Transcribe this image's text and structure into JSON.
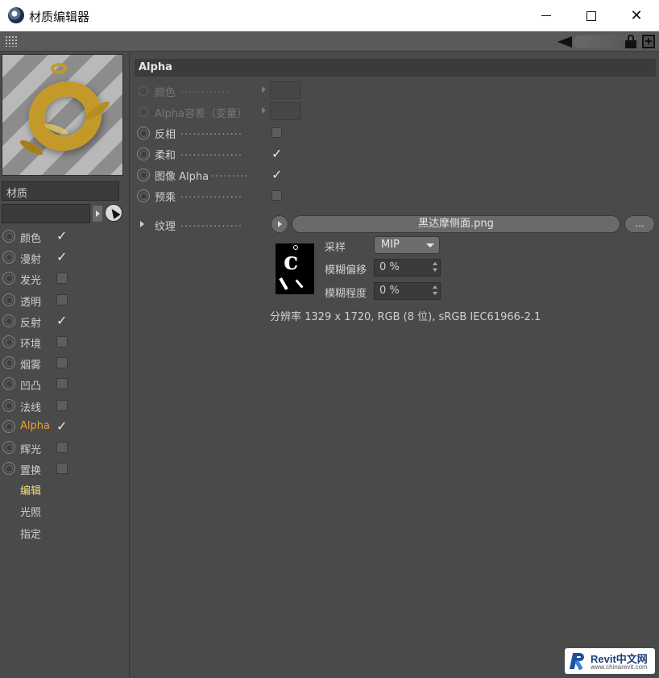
{
  "window": {
    "title": "材质编辑器",
    "minimize_icon": "minimize-icon",
    "maximize_icon": "maximize-icon",
    "close_glyph": "✕"
  },
  "material": {
    "name": "材质"
  },
  "channels": [
    {
      "label": "颜色",
      "checked": true,
      "active": false
    },
    {
      "label": "漫射",
      "checked": true,
      "active": false
    },
    {
      "label": "发光",
      "checked": false,
      "active": false
    },
    {
      "label": "透明",
      "checked": false,
      "active": false
    },
    {
      "label": "反射",
      "checked": true,
      "active": false
    },
    {
      "label": "环境",
      "checked": false,
      "active": false
    },
    {
      "label": "烟雾",
      "checked": false,
      "active": false
    },
    {
      "label": "凹凸",
      "checked": false,
      "active": false
    },
    {
      "label": "法线",
      "checked": false,
      "active": false
    },
    {
      "label": "Alpha",
      "checked": true,
      "active": true
    },
    {
      "label": "辉光",
      "checked": false,
      "active": false
    },
    {
      "label": "置换",
      "checked": false,
      "active": false
    }
  ],
  "menu_links": [
    {
      "label": "编辑",
      "active": true
    },
    {
      "label": "光照",
      "active": false
    },
    {
      "label": "指定",
      "active": false
    }
  ],
  "alpha": {
    "header": "Alpha",
    "props": [
      {
        "label": "颜色",
        "dots": "............",
        "kind": "swatch",
        "dim": true
      },
      {
        "label": "Alpha容差（变量）",
        "dots": "",
        "kind": "swatch",
        "dim": true
      },
      {
        "label": "反相",
        "dots": "...............",
        "kind": "check",
        "checked": false
      },
      {
        "label": "柔和",
        "dots": "...............",
        "kind": "check",
        "checked": true
      },
      {
        "label": "图像 Alpha",
        "dots": ".........",
        "kind": "check",
        "checked": true
      },
      {
        "label": "预乘",
        "dots": "...............",
        "kind": "check",
        "checked": false
      }
    ],
    "texture": {
      "label": "纹理",
      "dots": "...............",
      "file": "黑达摩侧面.png",
      "browse_label": "..."
    },
    "sampling": {
      "label": "采样",
      "value": "MIP"
    },
    "blur_offset": {
      "label": "模糊偏移",
      "value": "0 %"
    },
    "blur_scale": {
      "label": "模糊程度",
      "value": "0 %"
    },
    "resolution": "分辨率 1329 x 1720, RGB (8 位), sRGB IEC61966-2.1"
  },
  "check_glyph": "✓",
  "watermark": {
    "brand": "Revit中文网",
    "url": "www.chinarevit.com"
  }
}
